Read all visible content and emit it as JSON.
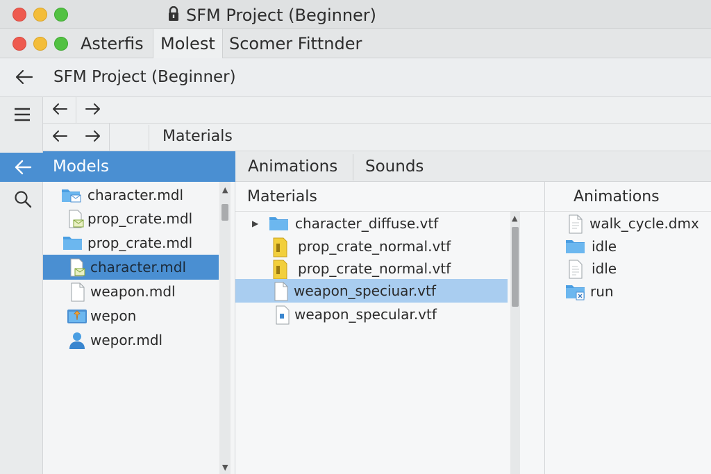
{
  "window": {
    "title": "SFM Project (Beginner)",
    "lock_icon": "lock-icon"
  },
  "tabs": [
    {
      "label": "Asterfis"
    },
    {
      "label": "Molest"
    },
    {
      "label": "Scomer Fittnder"
    }
  ],
  "address": {
    "title": "SFM Project (Beginner)"
  },
  "path": {
    "label": "Materials"
  },
  "columns": {
    "models_header": "Models",
    "tab_animations": "Animations",
    "tab_sounds": "Sounds",
    "materials_header": "Materials",
    "animations_header": "Animations"
  },
  "models": [
    {
      "label": "character.mdl",
      "icon": "folder-mail-icon"
    },
    {
      "label": "prop_crate.mdl",
      "icon": "file-mail-icon"
    },
    {
      "label": "prop_crate.mdl",
      "icon": "folder-icon"
    },
    {
      "label": "character.mdl",
      "icon": "file-mail-icon",
      "selected": true
    },
    {
      "label": "weapon.mdl",
      "icon": "file-icon"
    },
    {
      "label": "wepon",
      "icon": "pin-folder-icon"
    },
    {
      "label": "wepor.mdl",
      "icon": "user-icon"
    }
  ],
  "materials": [
    {
      "label": "character_diffuse.vtf",
      "icon": "folder-icon"
    },
    {
      "label": "prop_crate_normal.vtf",
      "icon": "yellow-file-icon"
    },
    {
      "label": "prop_crate_normal.vtf",
      "icon": "yellow-file-icon"
    },
    {
      "label": "weapon_speciuar.vtf",
      "icon": "file-icon",
      "selected": true
    },
    {
      "label": "weapon_specular.vtf",
      "icon": "image-file-icon"
    }
  ],
  "animations": [
    {
      "label": "walk_cycle.dmx",
      "icon": "file-icon"
    },
    {
      "label": "idle",
      "icon": "folder-icon"
    },
    {
      "label": "idle",
      "icon": "text-file-icon"
    },
    {
      "label": "run",
      "icon": "folder-x-icon"
    }
  ],
  "colors": {
    "accent": "#4a8fd2",
    "selection_light": "#a9cdf0",
    "close": "#ee5a4f",
    "minimize": "#f3bd3a",
    "zoom": "#52c142"
  }
}
